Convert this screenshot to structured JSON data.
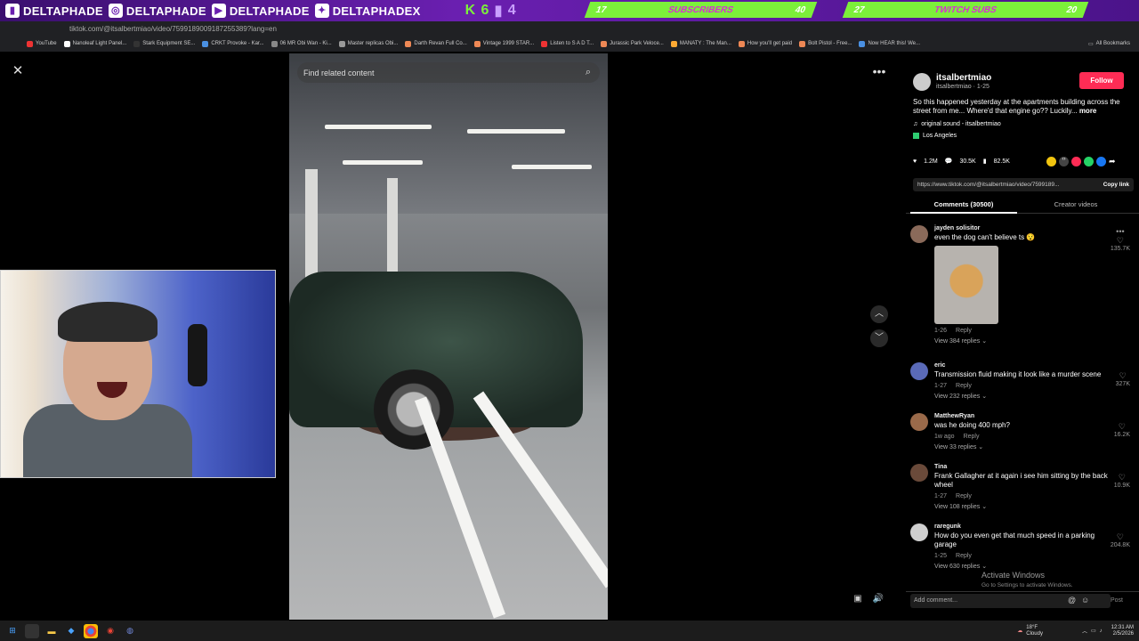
{
  "banner": {
    "handles": [
      "DELTAPHADE",
      "DELTAPHADE",
      "DELTAPHADE",
      "DELTAPHADEX"
    ],
    "kick_k": "K",
    "kick_count": "6",
    "twitch_count": "4",
    "subs_current": "17",
    "subs_label": "SUBSCRIBERS",
    "subs_goal": "40",
    "twitch_current": "27",
    "twitch_label": "TWITCH SUBS",
    "twitch_goal": "20"
  },
  "browser": {
    "url": "tiktok.com/@itsalbertmiao/video/7599189009187255389?lang=en",
    "bookmarks": [
      "YouTube",
      "Nanoleaf Light Panel...",
      "Stark Equipment SE...",
      "CRKT Provoke - Kar...",
      "06 MR Obi Wan - Ki...",
      "Master replicas Obi...",
      "Darth Revan Full Co...",
      "Vintage 1999 STAR...",
      "Listen to S A D T...",
      "Jurassic Park Veloce...",
      "MANATY : The Man...",
      "How you'll get paid",
      "Bolt Pistol - Free...",
      "Now HEAR this! We..."
    ],
    "all_bookmarks": "All Bookmarks"
  },
  "video": {
    "search_placeholder": "Find related content"
  },
  "post": {
    "author": "itsalbertmiao",
    "author_sub": "itsalbertmiao · 1-25",
    "follow_label": "Follow",
    "caption": "So this happened yesterday at the apartments building across the street from me... Where'd that engine go?? Luckily...",
    "more_label": "more",
    "sound": "original sound - itsalbertmiao",
    "location": "Los Angeles",
    "likes": "1.2M",
    "comments": "30.5K",
    "saves": "82.5K",
    "link": "https://www.tiktok.com/@itsalbertmiao/video/7599189...",
    "copy_link": "Copy link",
    "tab_comments": "Comments (30500)",
    "tab_creator": "Creator videos",
    "add_comment_placeholder": "Add comment...",
    "post_label": "Post"
  },
  "comments": [
    {
      "name": "jayden solisitor",
      "text": "even the dog can't believe ts 😯",
      "date": "1-26",
      "reply": "Reply",
      "replies": "View 384 replies",
      "likes": "135.7K",
      "avatar_color": "#8a6a5a"
    },
    {
      "name": "eric",
      "text": "Transmission fluid making it look like a murder scene",
      "date": "1-27",
      "reply": "Reply",
      "replies": "View 232 replies",
      "likes": "327K",
      "avatar_color": "#5a6ab8"
    },
    {
      "name": "MatthewRyan",
      "text": "was he doing 400 mph?",
      "date": "1w ago",
      "reply": "Reply",
      "replies": "View 33 replies",
      "likes": "16.2K",
      "avatar_color": "#9a6a4a"
    },
    {
      "name": "Tina",
      "text": "Frank Gallagher at it again i see him sitting by the back wheel",
      "date": "1-27",
      "reply": "Reply",
      "replies": "View 108 replies",
      "likes": "10.9K",
      "avatar_color": "#6a4a3a"
    },
    {
      "name": "raregunk",
      "text": "How do you even get that much speed in a parking garage",
      "date": "1-25",
      "reply": "Reply",
      "replies": "View 630 replies",
      "likes": "204.8K",
      "avatar_color": "#cfcfcf"
    }
  ],
  "windows": {
    "activate_title": "Activate Windows",
    "activate_sub": "Go to Settings to activate Windows.",
    "weather_temp": "18°F",
    "weather_desc": "Cloudy",
    "time": "12:31 AM",
    "date": "2/5/2026"
  }
}
